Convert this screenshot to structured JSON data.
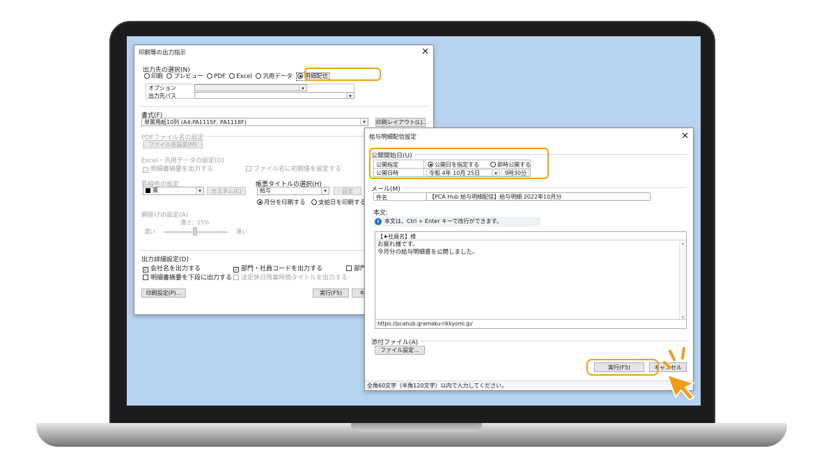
{
  "back_dialog": {
    "title": "印刷等の出力指示",
    "output_group_label": "出力先の選択(N)",
    "radios": [
      {
        "label": "印刷",
        "selected": false
      },
      {
        "label": "プレビュー",
        "selected": false
      },
      {
        "label": "PDF",
        "selected": false
      },
      {
        "label": "Excel",
        "selected": false
      },
      {
        "label": "汎用データ",
        "selected": false
      },
      {
        "label": "明細配信",
        "selected": true
      }
    ],
    "option_label": "オプション",
    "output_path_label": "出力先パス",
    "format_label": "書式(F)",
    "format_value": "単票用紙10列 (A4:PA1115F, PA1118F)",
    "print_layout_button": "印刷レイアウト(L)...",
    "pdf_filename_label": "PDFファイル名の設定",
    "filename_setting_button": "ファイル名設定(M)",
    "excel_setting_label": "Excel・汎用データの設定(O)",
    "excel_check1": "明細書摘要を出力する",
    "excel_check2": "ファイル名に初期値を設定する",
    "ruled_color_label": "罫線色の設定",
    "color_value": "黒",
    "custom_button": "カスタム(C)",
    "form_title_label": "帳票タイトルの選択(H)",
    "form_title_value": "給与",
    "setting_button": "設定",
    "month_radio": "月分を印刷する",
    "payday_radio": "支給日を印刷する",
    "mesh_label": "網掛けの設定(A)",
    "density_label": "濃さ：15%",
    "dark_label": "濃い",
    "light_label": "薄い",
    "detail_label": "出力詳細設定(D)",
    "detail_check1": "会社名を出力する",
    "detail_check2": "部門・社員コードを出力する",
    "detail_check3": "部門",
    "detail_check4": "明細書摘要を下段に出力する",
    "detail_check5": "法定休日残業時間タイトルを出力する",
    "print_setting_button": "印刷設定(P)...",
    "execute_button": "実行(F5)",
    "cancel_button_partial": "キ"
  },
  "front_dialog": {
    "title": "給与明細配信設定",
    "publish_date_label": "公開開始日(U)",
    "publish_spec_label": "公開指定",
    "publish_radio1": "公開日を指定する",
    "publish_radio2": "即時公開する",
    "publish_datetime_label": "公開日時",
    "publish_date_value": "令和  4年 10月 25日",
    "publish_time_value": "9時30分",
    "mail_label": "メール(M)",
    "subject_label": "件名",
    "subject_value": "【PCA Hub 給与明細配信】給与明細 2022年10月分",
    "body_label": "本文:",
    "info_text": "本文は、Ctrl + Enter キーで改行ができます。",
    "body_header": "【★社員名】様",
    "body_line1": "お疲れ様です。",
    "body_line2": "今月分の給与明細書を公開しました。",
    "url_line": "https://pcahub.gramaku-rikkyomi.jp/",
    "attachment_label": "添付ファイル(A)",
    "file_setting_button": "ファイル設定...",
    "execute_button": "実行(F5)",
    "cancel_button": "キャンセル",
    "status_text": "全角60文字（半角120文字）以内で入力してください。"
  },
  "colors": {
    "highlight": "#f39c12",
    "desktop": "#b7d3ef",
    "info_icon": "#1e6fd0"
  }
}
